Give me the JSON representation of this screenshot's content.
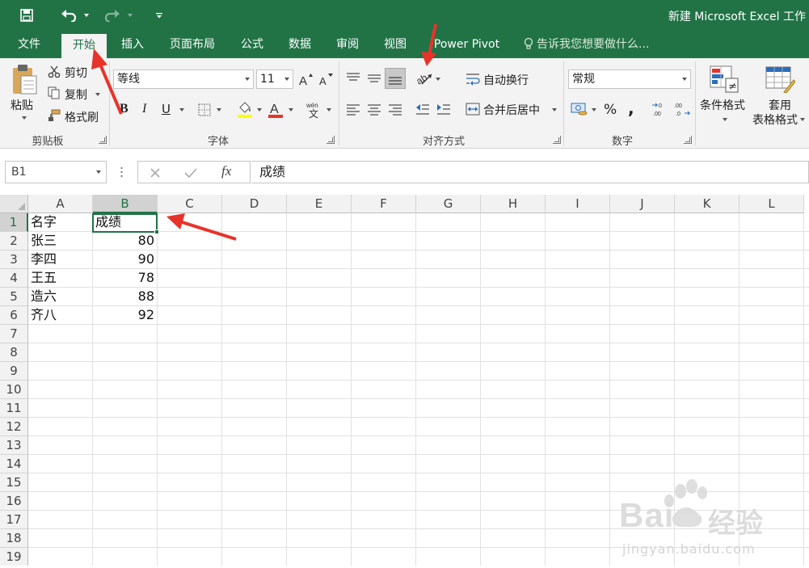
{
  "window": {
    "title": "新建 Microsoft Excel 工作"
  },
  "quick_access": {
    "save_icon": "save-icon",
    "undo_icon": "undo-icon",
    "redo_icon": "redo-icon",
    "customize_icon": "customize-qat-icon"
  },
  "tabs": [
    {
      "label": "文件"
    },
    {
      "label": "开始",
      "active": true
    },
    {
      "label": "插入"
    },
    {
      "label": "页面布局"
    },
    {
      "label": "公式"
    },
    {
      "label": "数据"
    },
    {
      "label": "审阅"
    },
    {
      "label": "视图"
    },
    {
      "label": "Power Pivot"
    }
  ],
  "tell_me": {
    "placeholder": "告诉我您想要做什么..."
  },
  "ribbon": {
    "clipboard": {
      "paste": "粘贴",
      "cut": "剪切",
      "copy": "复制",
      "format_painter": "格式刷",
      "label": "剪贴板"
    },
    "font": {
      "name": "等线",
      "size": "11",
      "label": "字体",
      "bold": "B",
      "italic": "I",
      "underline": "U"
    },
    "alignment": {
      "wrap_text": "自动换行",
      "merge_center": "合并后居中",
      "label": "对齐方式"
    },
    "number": {
      "format": "常规",
      "percent": "%",
      "comma": ",",
      "label": "数字"
    },
    "styles": {
      "conditional_format": "条件格式",
      "table_format_line1": "套用",
      "table_format_line2": "表格格式"
    }
  },
  "formula_bar": {
    "name_box": "B1",
    "content": "成绩",
    "fx_label": "fx"
  },
  "sheet": {
    "columns": [
      "A",
      "B",
      "C",
      "D",
      "E",
      "F",
      "G",
      "H",
      "I",
      "J",
      "K",
      "L"
    ],
    "selected_column": "B",
    "rows": [
      "1",
      "2",
      "3",
      "4",
      "5",
      "6",
      "7",
      "8",
      "9",
      "10",
      "11",
      "12",
      "13",
      "14",
      "15",
      "16",
      "17",
      "18",
      "19"
    ],
    "selected_row": "1",
    "selected_cell": "B1",
    "data": [
      {
        "a": "名字",
        "b": "成绩"
      },
      {
        "a": "张三",
        "b": "80"
      },
      {
        "a": "李四",
        "b": "90"
      },
      {
        "a": "王五",
        "b": "78"
      },
      {
        "a": "造六",
        "b": "88"
      },
      {
        "a": "齐八",
        "b": "92"
      }
    ]
  },
  "colors": {
    "excel_green": "#217346",
    "annotation_red": "#e8332a"
  },
  "watermark": {
    "brand": "Bai",
    "brand2": "经验",
    "url": "jingyan.baidu.com"
  }
}
